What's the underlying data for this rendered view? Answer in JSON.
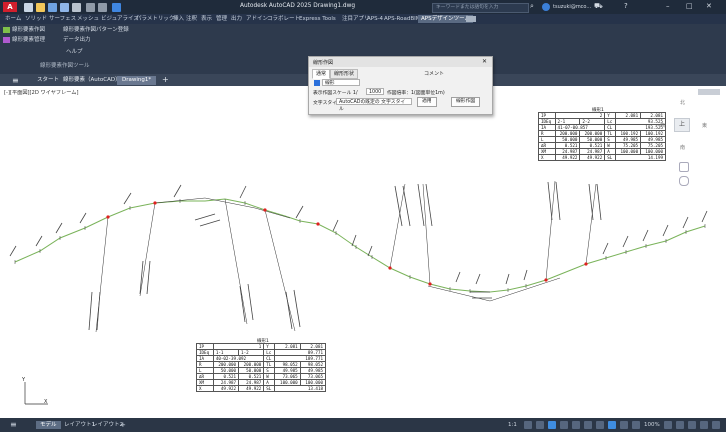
{
  "titlebar": {
    "logo": "A",
    "search_placeholder": "キーワードまたは語句を入力",
    "app_title": "Autodesk AutoCAD 2025  Drawing1.dwg",
    "user": "tsuzuki@mco..."
  },
  "ribbon_tabs": [
    "ホーム",
    "ソリッド",
    "サーフェス",
    "メッシュ",
    "ビジュアライズ",
    "パラメトリック",
    "挿入",
    "注釈",
    "表示",
    "管理",
    "出力",
    "アドイン",
    "コラボレート",
    "Express Tools",
    "注目アプリ",
    "APS-4",
    "APS-RoadBIM",
    "APSデザインツール"
  ],
  "ribbon_active_tab": "APSデザインツール",
  "ribbon_items": [
    {
      "label": "線形要素作図",
      "icon": "linear-element-icon",
      "color": "#7fc04a"
    },
    {
      "label": "線形要素作図パターン登録",
      "icon": "pattern-register-icon",
      "color": "#d0d0d0"
    },
    {
      "label": "線形要素管理",
      "icon": "linear-manage-icon",
      "color": "#b05ad0"
    },
    {
      "label": "データ出力",
      "icon": "data-output-icon",
      "color": "#d0d0d0"
    },
    {
      "label": "ヘルプ",
      "icon": "help-icon",
      "color": "#d0d0d0"
    },
    {
      "label": "線形要素作図ツール",
      "icon": "tool-icon",
      "color": "#d0d0d0"
    }
  ],
  "doc_tabs": [
    "スタート",
    "線形要素（AutoCAD）",
    "Drawing1*"
  ],
  "viewport_label": "[-][平面図][2D ワイヤフレーム]",
  "dialog": {
    "title": "線形作図",
    "tabs": [
      "通常",
      "線形形状"
    ],
    "comment_header": "コメント",
    "layer_value": "線形",
    "scale_label": "表示作図スケール 1/",
    "scale_value": "1000",
    "scale_mode": "作図倍率：1(図面単位1m)",
    "style_label": "文字スタイル",
    "style_value": "AutoCADの既定の 文字スタイル",
    "apply_button": "適用",
    "draw_button": "線形作図"
  },
  "table1": {
    "title": "線形1",
    "rows": [
      [
        "IP",
        "2",
        "Y",
        "2.081",
        "2.081"
      ],
      [
        "IDEq",
        "2-1",
        "2-2",
        "Lc",
        "93.525"
      ],
      [
        "IA",
        "41-07-00.857",
        "",
        "CL",
        "193.525"
      ],
      [
        "R",
        "200.000",
        "200.000",
        "TL",
        "100.192",
        "100.192"
      ],
      [
        "L",
        "50.000",
        "50.000",
        "S",
        "49.985",
        "49.985"
      ],
      [
        "ΔR",
        "0.521",
        "0.521",
        "W",
        "75.205",
        "75.205"
      ],
      [
        "XM",
        "24.987",
        "24.987",
        "A",
        "100.000",
        "100.000"
      ],
      [
        "X",
        "49.922",
        "49.922",
        "SL",
        "14.199"
      ]
    ]
  },
  "table2": {
    "title": "線形1",
    "rows": [
      [
        "IP",
        "1",
        "Y",
        "2.081",
        "2.081"
      ],
      [
        "IDEq",
        "1-1",
        "1-2",
        "Lc",
        "89.771"
      ],
      [
        "IA",
        "40-02-39.092",
        "",
        "CL",
        "189.771"
      ],
      [
        "R",
        "200.000",
        "200.000",
        "TL",
        "98.052",
        "98.052"
      ],
      [
        "L",
        "50.000",
        "50.000",
        "S",
        "49.985",
        "49.985"
      ],
      [
        "ΔR",
        "0.521",
        "0.521",
        "W",
        "73.065",
        "73.065"
      ],
      [
        "XM",
        "24.987",
        "24.987",
        "A",
        "100.000",
        "100.000"
      ],
      [
        "X",
        "49.922",
        "49.922",
        "SL",
        "13.418"
      ]
    ]
  },
  "viewcube_label": "上",
  "viewcube_directions": [
    "北",
    "東",
    "南",
    "西"
  ],
  "ucs": {
    "y": "Y",
    "x": "X"
  },
  "statusbar": {
    "tabs": [
      "モデル",
      "レイアウト1",
      "レイアウト2"
    ],
    "add_tab": "+",
    "scale_readout": "1:1",
    "zoom_readout": "100%"
  }
}
